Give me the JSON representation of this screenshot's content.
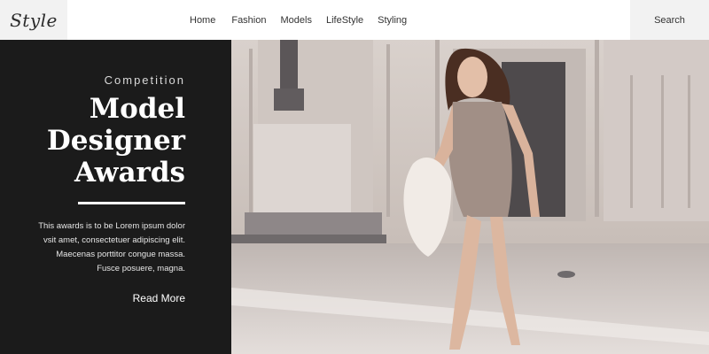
{
  "header": {
    "logo": "Style",
    "nav": [
      "Home",
      "Fashion",
      "Models",
      "LifeStyle",
      "Styling"
    ],
    "search_label": "Search"
  },
  "promo": {
    "kicker": "Competition",
    "title_lines": [
      "Model",
      "Designer",
      "Awards"
    ],
    "description_lines": [
      "This awards is to be Lorem ipsum dolor",
      "vsit amet, consectetuer adipiscing elit.",
      "Maecenas porttitor congue massa.",
      "Fusce posuere, magna."
    ],
    "cta": "Read More"
  },
  "colors": {
    "panel_bg": "#1b1b1b",
    "header_box_bg": "#f2f2f2"
  }
}
